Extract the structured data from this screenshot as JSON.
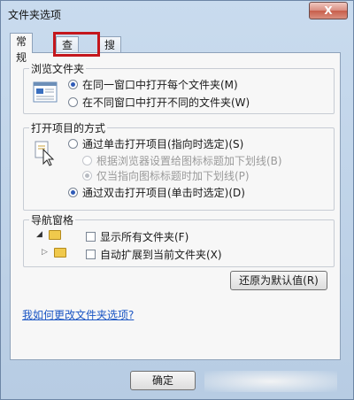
{
  "window": {
    "title": "文件夹选项",
    "close_label": "X"
  },
  "tabs": [
    {
      "label": "常规"
    },
    {
      "label": "查看"
    },
    {
      "label": "搜索"
    }
  ],
  "browse": {
    "title": "浏览文件夹",
    "options": [
      {
        "label": "在同一窗口中打开每个文件夹(M)",
        "checked": true
      },
      {
        "label": "在不同窗口中打开不同的文件夹(W)",
        "checked": false
      }
    ]
  },
  "open_items": {
    "title": "打开项目的方式",
    "options": [
      {
        "label": "通过单击打开项目(指向时选定)(S)",
        "checked": false,
        "disabled": false
      },
      {
        "label": "根据浏览器设置给图标标题加下划线(B)",
        "checked": false,
        "disabled": true
      },
      {
        "label": "仅当指向图标标题时加下划线(P)",
        "checked": true,
        "disabled": true
      },
      {
        "label": "通过双击打开项目(单击时选定)(D)",
        "checked": true,
        "disabled": false
      }
    ]
  },
  "nav_pane": {
    "title": "导航窗格",
    "options": [
      {
        "label": "显示所有文件夹(F)",
        "checked": false
      },
      {
        "label": "自动扩展到当前文件夹(X)",
        "checked": false
      }
    ]
  },
  "restore_button": "还原为默认值(R)",
  "help_link": "我如何更改文件夹选项?",
  "ok_button": "确定"
}
